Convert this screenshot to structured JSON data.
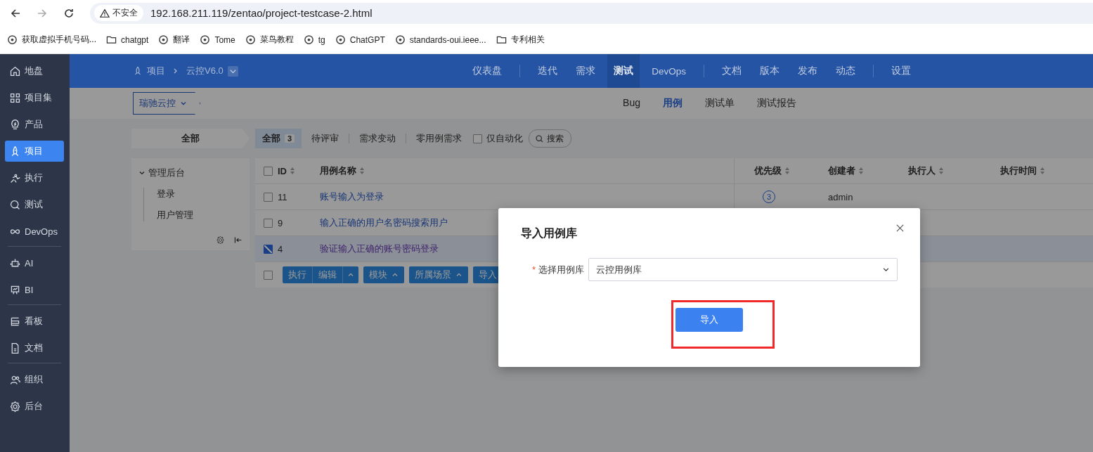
{
  "browser": {
    "security": "不安全",
    "url": "192.168.211.119/zentao/project-testcase-2.html",
    "bookmarks": [
      {
        "label": "获取虚拟手机号码...",
        "kind": "site"
      },
      {
        "label": "chatgpt",
        "kind": "folder"
      },
      {
        "label": "翻译",
        "kind": "site"
      },
      {
        "label": "Tome",
        "kind": "site"
      },
      {
        "label": "菜鸟教程",
        "kind": "site"
      },
      {
        "label": "tg",
        "kind": "site"
      },
      {
        "label": "ChatGPT",
        "kind": "site"
      },
      {
        "label": "standards-oui.ieee...",
        "kind": "site"
      },
      {
        "label": "专利相关",
        "kind": "folder"
      }
    ]
  },
  "sidebar": {
    "groups": [
      [
        {
          "label": "地盘",
          "selected": false
        },
        {
          "label": "项目集",
          "selected": false
        },
        {
          "label": "产品",
          "selected": false
        },
        {
          "label": "项目",
          "selected": true
        },
        {
          "label": "执行",
          "selected": false
        },
        {
          "label": "测试",
          "selected": false
        },
        {
          "label": "DevOps",
          "selected": false
        }
      ],
      [
        {
          "label": "AI",
          "selected": false
        },
        {
          "label": "BI",
          "selected": false
        }
      ],
      [
        {
          "label": "看板",
          "selected": false
        },
        {
          "label": "文档",
          "selected": false
        }
      ],
      [
        {
          "label": "组织",
          "selected": false
        },
        {
          "label": "后台",
          "selected": false
        }
      ]
    ]
  },
  "header": {
    "breadcrumb": [
      "项目",
      "云控V6.0"
    ],
    "nav_groups": [
      [
        {
          "label": "仪表盘",
          "selected": false
        }
      ],
      [
        {
          "label": "迭代",
          "selected": false
        },
        {
          "label": "需求",
          "selected": false
        },
        {
          "label": "测试",
          "selected": true
        },
        {
          "label": "DevOps",
          "selected": false
        }
      ],
      [
        {
          "label": "文档",
          "selected": false
        },
        {
          "label": "版本",
          "selected": false
        },
        {
          "label": "发布",
          "selected": false
        },
        {
          "label": "动态",
          "selected": false
        }
      ],
      [
        {
          "label": "设置",
          "selected": false
        }
      ]
    ]
  },
  "subnav": {
    "product": "瑞驰云控",
    "tabs": [
      {
        "label": "Bug",
        "selected": false
      },
      {
        "label": "用例",
        "selected": true
      },
      {
        "label": "测试单",
        "selected": false
      },
      {
        "label": "测试报告",
        "selected": false
      }
    ]
  },
  "module_header": "全部",
  "filters": {
    "tabs": [
      {
        "label": "全部",
        "count": "3",
        "selected": true
      },
      {
        "label": "待评审",
        "selected": false
      },
      {
        "label": "需求变动",
        "selected": false
      },
      {
        "label": "零用例需求",
        "selected": false
      }
    ],
    "auto_only": {
      "label": "仅自动化",
      "checked": false
    },
    "search": "搜索"
  },
  "tree": [
    {
      "label": "管理后台",
      "expanded": true,
      "children": [
        {
          "label": "登录"
        },
        {
          "label": "用户管理"
        }
      ]
    }
  ],
  "table": {
    "columns": [
      "ID",
      "用例名称",
      "优先级",
      "创建者",
      "执行人",
      "执行时间"
    ],
    "rows": [
      {
        "id": "11",
        "title": "账号输入为登录",
        "priority": "3",
        "creator": "admin",
        "checked": false
      },
      {
        "id": "9",
        "title": "输入正确的用户名密码搜索用户",
        "checked": false
      },
      {
        "id": "4",
        "title": "验证输入正确的账号密码登录",
        "checked": true
      }
    ],
    "footer": {
      "select_all": false,
      "actions": [
        {
          "label": "执行",
          "kind": "split"
        },
        {
          "label": "编辑",
          "kind": "caret"
        },
        {
          "label": "模块",
          "kind": "menu"
        },
        {
          "label": "所属场景",
          "kind": "menu"
        },
        {
          "label": "导入",
          "kind": "plain"
        }
      ]
    }
  },
  "modal": {
    "title": "导入用例库",
    "field": {
      "label": "选择用例库",
      "required_mark": "*",
      "value": "云控用例库"
    },
    "button": "导入"
  }
}
